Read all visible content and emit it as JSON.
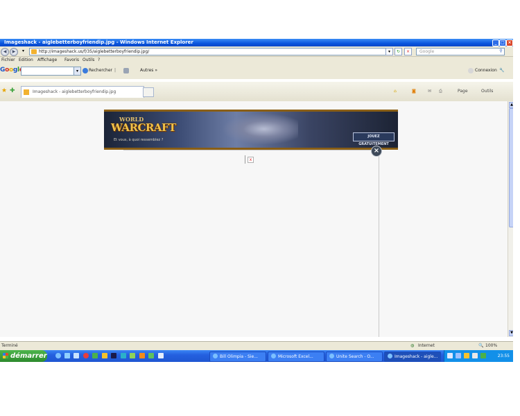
{
  "window": {
    "title": "Imageshack - aiglebetterboyfriendip.jpg - Windows Internet Explorer",
    "controls": [
      "minimize",
      "maximize",
      "close"
    ]
  },
  "address_bar": {
    "url": "http://imageshack.us/f/35/aiglebetterboyfriendip.jpg/",
    "search_placeholder": "Google",
    "back_icon": "back-arrow-icon",
    "forward_icon": "forward-arrow-icon"
  },
  "menu": {
    "items": [
      "Fichier",
      "Edition",
      "Affichage",
      "Favoris",
      "Outils",
      "?"
    ]
  },
  "google_toolbar": {
    "logo": "Google",
    "search_label": "Rechercher",
    "more_label": "Autres »",
    "signin_label": "Connexion"
  },
  "tabs": {
    "active_title": "Imageshack - aiglebetterboyfriendip.jpg"
  },
  "command_bar": {
    "page_label": "Page",
    "tools_label": "Outils"
  },
  "banner": {
    "logo_top": "WORLD",
    "logo_main": "WARCRAFT",
    "tagline": "Et vous, à quoi ressemblez ?",
    "cta": "JOUEZ GRATUITEMENT"
  },
  "status_bar": {
    "left": "Terminé",
    "zone": "Internet",
    "zoom": "100%"
  },
  "taskbar": {
    "start_label": "démarrer",
    "tasks": [
      {
        "label": "Bill Olimpia - Sie..."
      },
      {
        "label": "Microsoft Excel..."
      },
      {
        "label": "Unite Search - O..."
      },
      {
        "label": "Imageshack - aigle..."
      }
    ],
    "clock": "23:55"
  },
  "colors": {
    "titlebar": "#0a55de",
    "taskbar": "#2460df",
    "start": "#2c8a2c",
    "chrome": "#ece9d8"
  }
}
